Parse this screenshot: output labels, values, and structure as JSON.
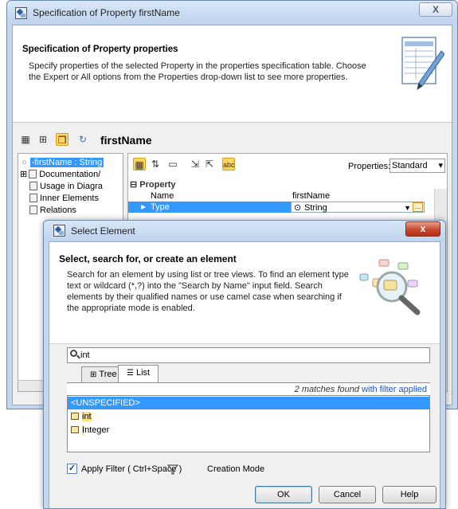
{
  "outer": {
    "title": "Specification of Property firstName",
    "close_glyph": "X",
    "header_title": "Specification of Property properties",
    "header_desc": "Specify properties of the selected Property in the properties specification table. Choose the Expert or All options from the Properties drop-down list to see more properties.",
    "element_name": "firstName",
    "tree": {
      "items": [
        "-firstName : String",
        "Documentation/",
        "Usage in Diagra",
        "Inner Elements",
        "Relations"
      ]
    },
    "props": {
      "properties_label": "Properties:",
      "properties_value": "Standard",
      "abc_icon": "abc",
      "group": "Property",
      "rows": [
        {
          "name": "Name",
          "value": "firstName"
        },
        {
          "name": "Type",
          "value": "String"
        }
      ]
    }
  },
  "dialog": {
    "title": "Select Element",
    "close_glyph": "x",
    "header_title": "Select, search for, or create an element",
    "header_desc": "Search for an element by using list or tree views. To find an element type text or wildcard (*,?) into the \"Search by Name\" input field. Search elements by their qualified names or use camel case when searching if the appropriate mode is enabled.",
    "search_value": "int",
    "tabs": [
      {
        "label": "Tree"
      },
      {
        "label": "List"
      }
    ],
    "matches_text": "2 matches found",
    "filter_text": "with filter applied",
    "list_items": [
      {
        "prefix": "<UNSPECIFIED>",
        "highlight": "",
        "suffix": ""
      },
      {
        "prefix": "",
        "highlight": "int",
        "suffix": ""
      },
      {
        "prefix": "",
        "highlight": "I",
        "suffix": "nteger"
      }
    ],
    "apply_filter_label": "Apply Filter ( Ctrl+Space )",
    "creation_mode_label": "Creation Mode",
    "buttons": {
      "ok": "OK",
      "cancel": "Cancel",
      "help": "Help"
    }
  },
  "colors": {
    "selection": "#3399ff",
    "highlight": "#ffe07a",
    "link": "#1a55c4",
    "title_bar": "#c4d7ee"
  }
}
